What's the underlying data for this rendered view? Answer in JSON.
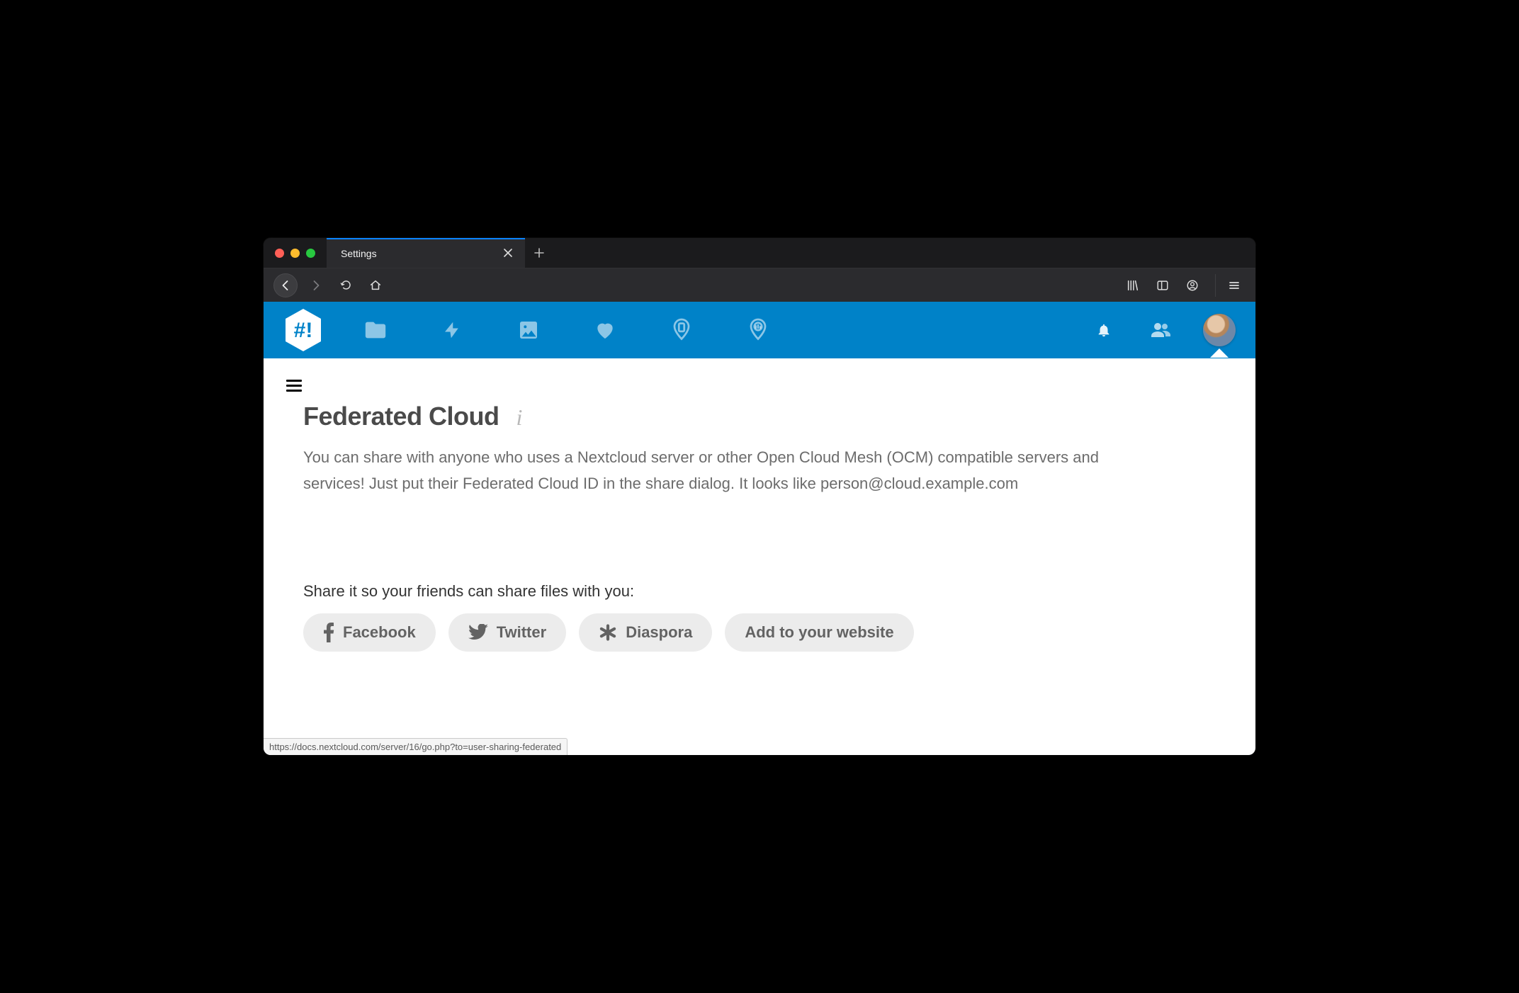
{
  "browser": {
    "tab_title": "Settings",
    "status_url": "https://docs.nextcloud.com/server/16/go.php?to=user-sharing-federated"
  },
  "page": {
    "heading": "Federated Cloud",
    "description": "You can share with anyone who uses a Nextcloud server or other Open Cloud Mesh (OCM) compatible servers and services! Just put their Federated Cloud ID in the share dialog. It looks like person@cloud.example.com",
    "share_label": "Share it so your friends can share files with you:",
    "share_buttons": {
      "facebook": "Facebook",
      "twitter": "Twitter",
      "diaspora": "Diaspora",
      "website": "Add to your website"
    }
  }
}
